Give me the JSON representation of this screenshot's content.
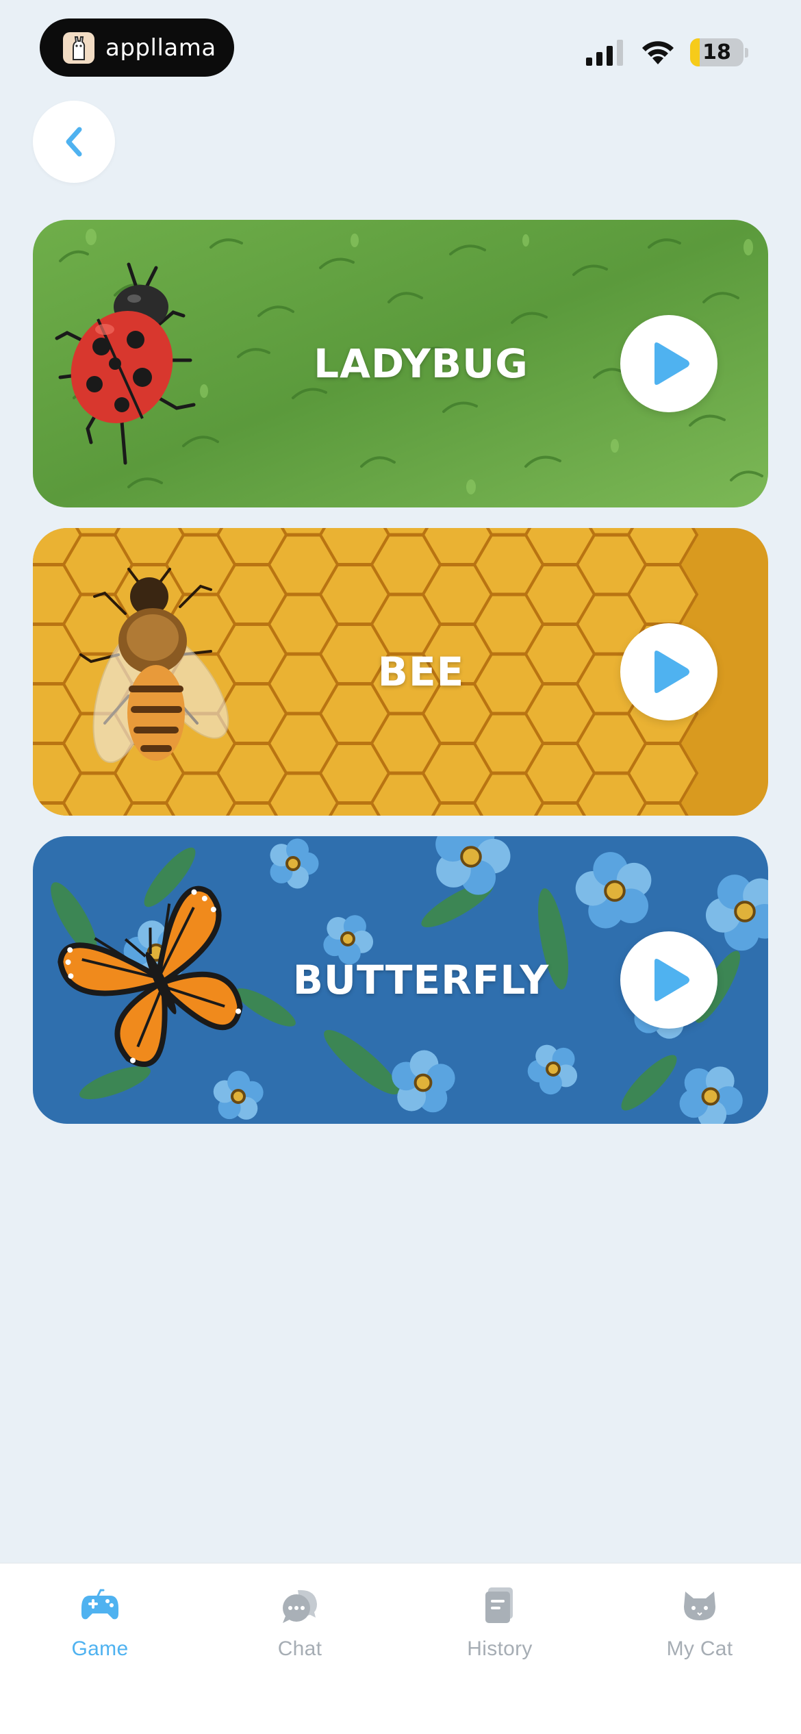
{
  "status_bar": {
    "brand_name": "appllama",
    "battery_level": "18",
    "battery_fraction": 0.18
  },
  "navigation": {
    "back_icon": "chevron-left-icon"
  },
  "cards": [
    {
      "title": "LADYBUG",
      "insect": "ladybug",
      "background": "green-grass",
      "play_icon": "play-icon"
    },
    {
      "title": "BEE",
      "insect": "bee",
      "background": "honeycomb",
      "play_icon": "play-icon"
    },
    {
      "title": "BUTTERFLY",
      "insect": "butterfly",
      "background": "blue-flowers",
      "play_icon": "play-icon"
    }
  ],
  "tab_bar": {
    "active": "Game",
    "tabs": [
      {
        "label": "Game",
        "icon": "gamepad-icon"
      },
      {
        "label": "Chat",
        "icon": "chat-bubbles-icon"
      },
      {
        "label": "History",
        "icon": "book-icon"
      },
      {
        "label": "My Cat",
        "icon": "cat-icon"
      }
    ]
  },
  "colors": {
    "background": "#e9f0f6",
    "accent": "#4fb2f0",
    "tab_inactive": "#a6adb4",
    "card_ladybug": "#5f9a3e",
    "card_bee": "#e0a21c",
    "card_butterfly": "#2f6fae"
  }
}
